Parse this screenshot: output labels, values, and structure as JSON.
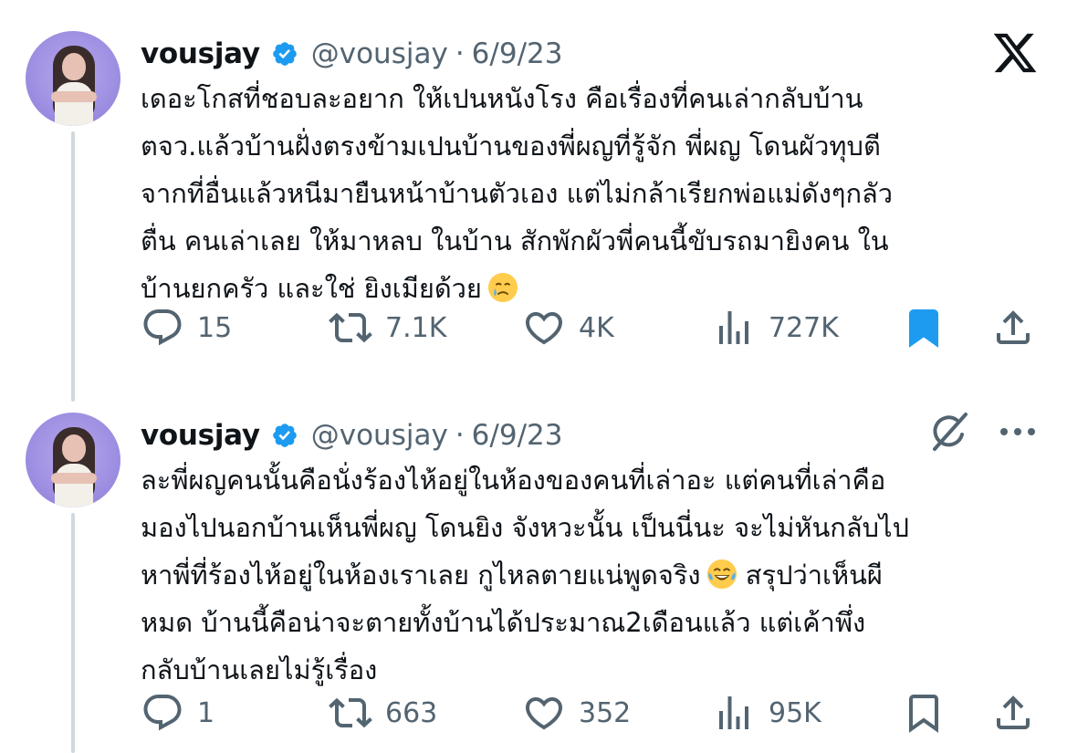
{
  "colors": {
    "text": "#0f1419",
    "secondary": "#536471",
    "verified": "#1d9bf0",
    "bookmark_active": "#1d9bf0",
    "thread_line": "#cfd9de"
  },
  "tweets": [
    {
      "author": {
        "name": "vousjay",
        "handle": "@vousjay",
        "separator": "·",
        "date": "6/9/23",
        "verified_icon": "verified-badge-icon"
      },
      "body_lines": [
        "เดอะโกสที่ชอบละอยาก ให้เปนหนังโรง คือเรื่องที่คนเล่ากลับบ้าน",
        "ตจว.แล้วบ้านฝั่งตรงข้ามเปนบ้านของพี่ผญที่รู้จัก พี่ผญ โดนผัวทุบตี",
        "จากที่อื่นแล้วหนีมายืนหน้าบ้านตัวเอง แต่ไม่กล้าเรียกพ่อแม่ดังๆกลัว",
        "ตื่น คนเล่าเลย ให้มาหลบ ในบ้าน สักพักผัวพี่คนนี้ขับรถมายิงคน ใน",
        "บ้านยกครัว และใช่ ยิงเมียด้วย"
      ],
      "emoji": "crying-face-emoji",
      "actions": {
        "replies": "15",
        "reposts": "7.1K",
        "likes": "4K",
        "views": "727K",
        "bookmarked": true
      },
      "top_right_icon": "x-logo-icon"
    },
    {
      "author": {
        "name": "vousjay",
        "handle": "@vousjay",
        "separator": "·",
        "date": "6/9/23",
        "verified_icon": "verified-badge-icon"
      },
      "body_lines": [
        "ละพี่ผญคนนั้นคือนั่งร้องไห้อยู่ในห้องของคนที่เล่าอะ แต่คนที่เล่าคือ",
        "มองไปนอกบ้านเห็นพี่ผญ โดนยิง จังหวะนั้น เป็นนี่นะ จะไม่หันกลับไป",
        "หาพี่ที่ร้องไห้อยู่ในห้องเราเลย กูไหลตายแน่พูดจริง",
        " สรุปว่าเห็นผี",
        "หมด บ้านนี้คือน่าจะตายทั้งบ้านได้ประมาณ2เดือนแล้ว แต่เค้าพึ่ง",
        "กลับบ้านเลยไม่รู้เรื่อง"
      ],
      "emoji": "tears-of-joy-emoji",
      "actions": {
        "replies": "1",
        "reposts": "663",
        "likes": "352",
        "views": "95K",
        "bookmarked": false
      },
      "top_right_icons": [
        "grok-icon",
        "more-options-icon"
      ]
    }
  ]
}
